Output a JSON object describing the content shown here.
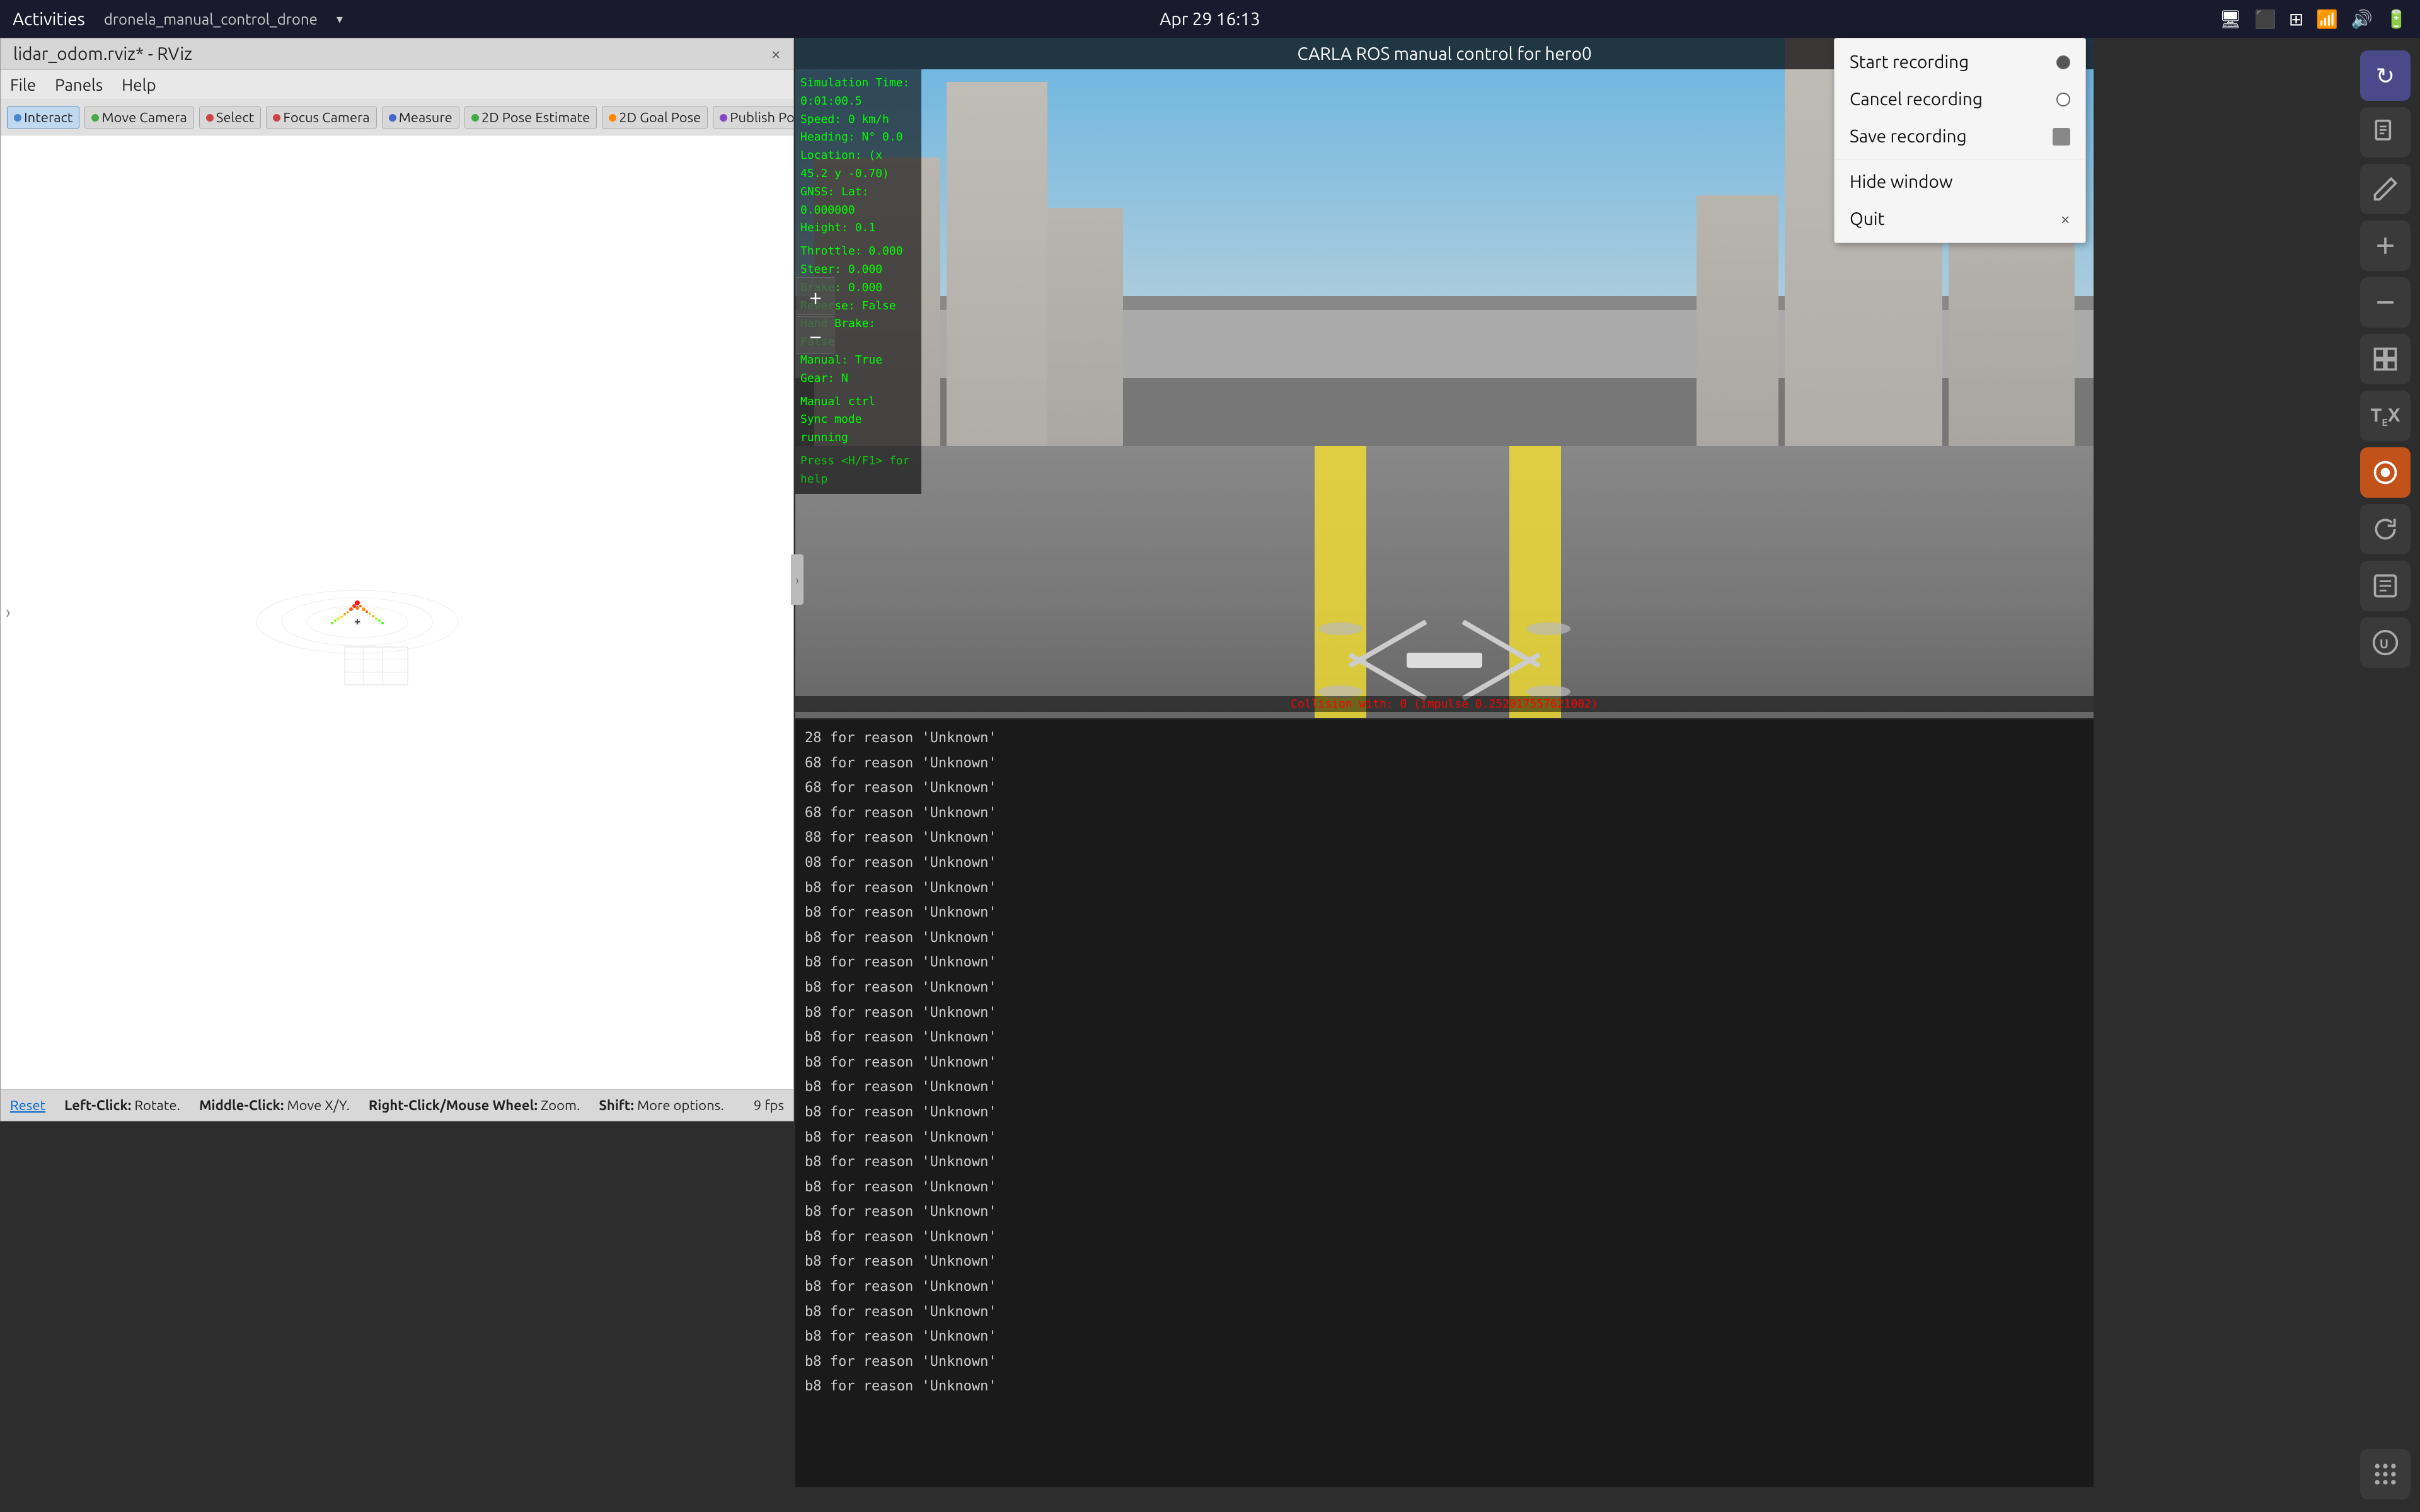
{
  "system_bar": {
    "activities": "Activities",
    "app_name": "dronela_manual_control_drone",
    "datetime": "Apr 29  16:13",
    "icons": [
      "network-icon",
      "wifi-icon",
      "volume-icon",
      "battery-icon"
    ]
  },
  "rviz": {
    "title": "lidar_odom.rviz* - RViz",
    "close_label": "×",
    "menu": {
      "file": "File",
      "panels": "Panels",
      "help": "Help"
    },
    "toolbar": [
      {
        "label": "Interact",
        "color": "#4488cc",
        "active": true
      },
      {
        "label": "Move Camera",
        "color": "#44aa44",
        "active": false
      },
      {
        "label": "Select",
        "color": "#cc4444",
        "active": false
      },
      {
        "label": "Focus Camera",
        "color": "#cc4444",
        "active": false
      },
      {
        "label": "Measure",
        "color": "#4466cc",
        "active": false
      },
      {
        "label": "2D Pose Estimate",
        "color": "#44aa44",
        "active": false
      },
      {
        "label": "2D Goal Pose",
        "color": "#ff8800",
        "active": false
      },
      {
        "label": "Publish Point",
        "color": "#8844cc",
        "active": false
      }
    ],
    "statusbar": {
      "reset": "Reset",
      "left_click": "Left-Click:",
      "left_click_action": "Rotate.",
      "middle_click": "Middle-Click:",
      "middle_click_action": "Move X/Y.",
      "right_click": "Right-Click/Mouse Wheel:",
      "right_click_action": "Zoom.",
      "shift": "Shift:",
      "shift_action": "More options.",
      "fps": "9 fps"
    }
  },
  "carla": {
    "title": "CARLA ROS manual control for hero0",
    "hud": {
      "simulation_time_label": "Simulation Time:",
      "simulation_time": "0:01:00.5",
      "speed_label": "Speed:",
      "speed": "0 km/h",
      "heading_label": "Heading:",
      "heading": "N°  0.0",
      "location_label": "Location:",
      "location": "(x 45.2  y -0.70)",
      "gnss_label": "GNSS:",
      "gnss": "Lat: 0.000000",
      "height_label": "Height:",
      "height": "0.1",
      "throttle_label": "Throttle:",
      "throttle": "0.000",
      "steer_label": "Steer:",
      "steer": "0.000",
      "brake_label": "Brake:",
      "brake": "0.000",
      "reverse_label": "Reverse:",
      "reverse": "False",
      "hand_brake_label": "Hand Brake:",
      "hand_brake": "False",
      "manual_label": "Manual:",
      "manual": "True",
      "gear_label": "Gear:",
      "gear": "N",
      "manual_ctrl": "Manual ctrl",
      "sync_mode": "Sync mode running"
    },
    "collision_text": "Collision with: 0 (impulse 0.252017557621002)",
    "hint": "Press <H/F1> for help"
  },
  "console": {
    "lines": [
      "28 for reason 'Unknown'",
      "68 for reason 'Unknown'",
      "68 for reason 'Unknown'",
      "68 for reason 'Unknown'",
      "88 for reason 'Unknown'",
      "08 for reason 'Unknown'",
      "b8 for reason 'Unknown'",
      "b8 for reason 'Unknown'",
      "b8 for reason 'Unknown'",
      "b8 for reason 'Unknown'",
      "b8 for reason 'Unknown'",
      "b8 for reason 'Unknown'",
      "b8 for reason 'Unknown'",
      "b8 for reason 'Unknown'",
      "b8 for reason 'Unknown'",
      "b8 for reason 'Unknown'",
      "b8 for reason 'Unknown'",
      "b8 for reason 'Unknown'",
      "b8 for reason 'Unknown'",
      "b8 for reason 'Unknown'",
      "b8 for reason 'Unknown'",
      "b8 for reason 'Unknown'",
      "b8 for reason 'Unknown'",
      "b8 for reason 'Unknown'",
      "b8 for reason 'Unknown'",
      "b8 for reason 'Unknown'",
      "b8 for reason 'Unknown'"
    ]
  },
  "recording_menu": {
    "start_recording": "Start recording",
    "cancel_recording": "Cancel recording",
    "save_recording": "Save recording",
    "hide_window": "Hide window",
    "quit": "Quit",
    "close_label": "×"
  },
  "right_sidebar": {
    "icons": [
      {
        "name": "refresh-icon",
        "symbol": "↻"
      },
      {
        "name": "pdf-icon",
        "symbol": "📄"
      },
      {
        "name": "edit-icon",
        "symbol": "✏"
      },
      {
        "name": "plus-icon",
        "symbol": "+"
      },
      {
        "name": "minus-icon",
        "symbol": "−"
      },
      {
        "name": "panel-icon",
        "symbol": "▦"
      },
      {
        "name": "tex-icon",
        "symbol": "T"
      },
      {
        "name": "color-icon",
        "symbol": "◉"
      },
      {
        "name": "update-icon",
        "symbol": "⟳"
      },
      {
        "name": "doc-icon",
        "symbol": "📝"
      },
      {
        "name": "unreal-icon",
        "symbol": "U"
      },
      {
        "name": "apps-icon",
        "symbol": "⋮⋮⋮"
      }
    ]
  }
}
